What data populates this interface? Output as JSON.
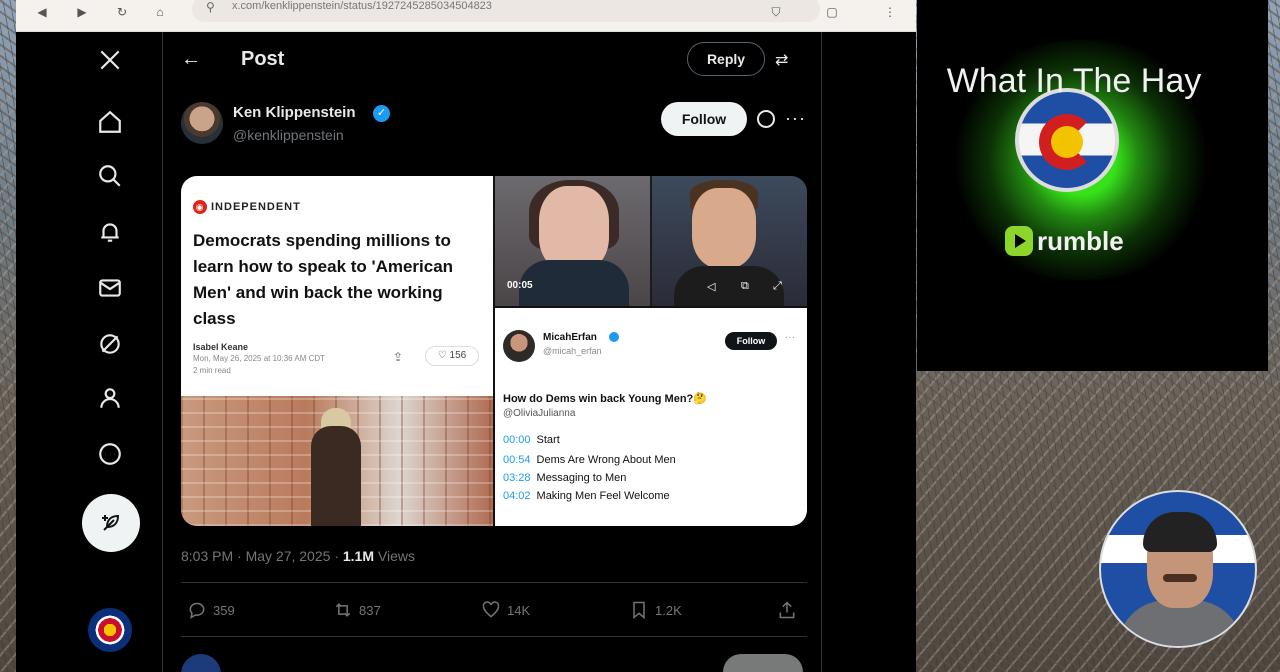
{
  "browser": {
    "url": "x.com/kenklippenstein/status/1927245285034504823"
  },
  "header": {
    "title": "Post",
    "reply_label": "Reply"
  },
  "post": {
    "author_name": "Ken Klippenstein",
    "author_handle": "@kenklippenstein",
    "follow_label": "Follow",
    "timestamp": "8:03 PM · May 27, 2025 · ",
    "views_count": "1.1M",
    "views_label": " Views",
    "stats": {
      "replies": "359",
      "reposts": "837",
      "likes": "14K",
      "bookmarks": "1.2K"
    }
  },
  "article": {
    "publication": "INDEPENDENT",
    "headline": "Democrats spending millions to learn how to speak to 'American Men' and win back the working class",
    "author": "Isabel Keane",
    "date": "Mon, May 26, 2025 at 10:36 AM CDT",
    "read_time": "2 min read",
    "likes": "156"
  },
  "video": {
    "time": "00:05"
  },
  "embedded_tweet": {
    "name": "MicahErfan",
    "handle": "@micah_erfan",
    "follow_label": "Follow",
    "text": "How do Dems win back Young Men?🤔",
    "mention": "@OliviaJulianna",
    "chapters": [
      {
        "time": "00:00",
        "label": "Start"
      },
      {
        "time": "00:54",
        "label": "Dems Are Wrong About Men"
      },
      {
        "time": "03:28",
        "label": "Messaging to Men"
      },
      {
        "time": "04:02",
        "label": "Making Men Feel Welcome"
      }
    ]
  },
  "overlay": {
    "title": "What In The Hay",
    "platform": "rumble"
  }
}
